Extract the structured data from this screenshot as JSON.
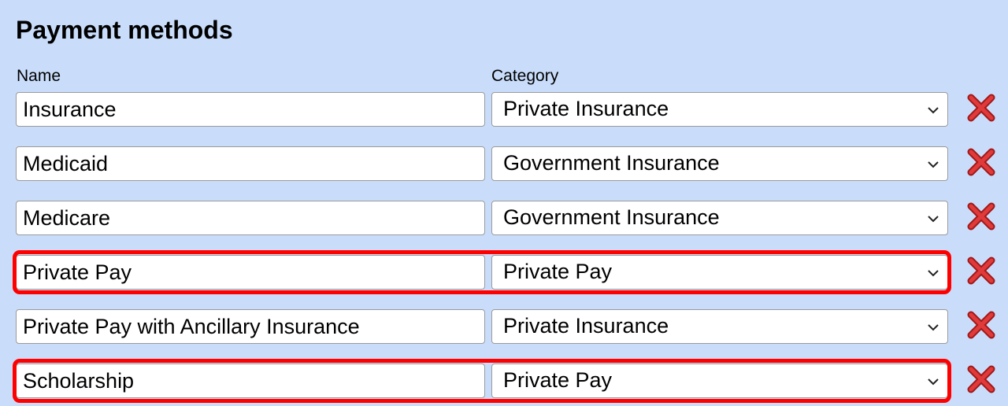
{
  "section": {
    "title": "Payment methods",
    "name_header": "Name",
    "category_header": "Category"
  },
  "payment_methods": [
    {
      "name": "Insurance",
      "category": "Private Insurance",
      "highlighted": false
    },
    {
      "name": "Medicaid",
      "category": "Government Insurance",
      "highlighted": false
    },
    {
      "name": "Medicare",
      "category": "Government Insurance",
      "highlighted": false
    },
    {
      "name": "Private Pay",
      "category": "Private Pay",
      "highlighted": true
    },
    {
      "name": "Private Pay with Ancillary Insurance",
      "category": "Private Insurance",
      "highlighted": false
    },
    {
      "name": "Scholarship",
      "category": "Private Pay",
      "highlighted": true
    }
  ],
  "icons": {
    "delete": "close-icon",
    "dropdown": "chevron-down-icon"
  },
  "colors": {
    "background": "#c9ddfb",
    "highlight": "#ff0000",
    "delete_icon": "#d42a2a"
  }
}
